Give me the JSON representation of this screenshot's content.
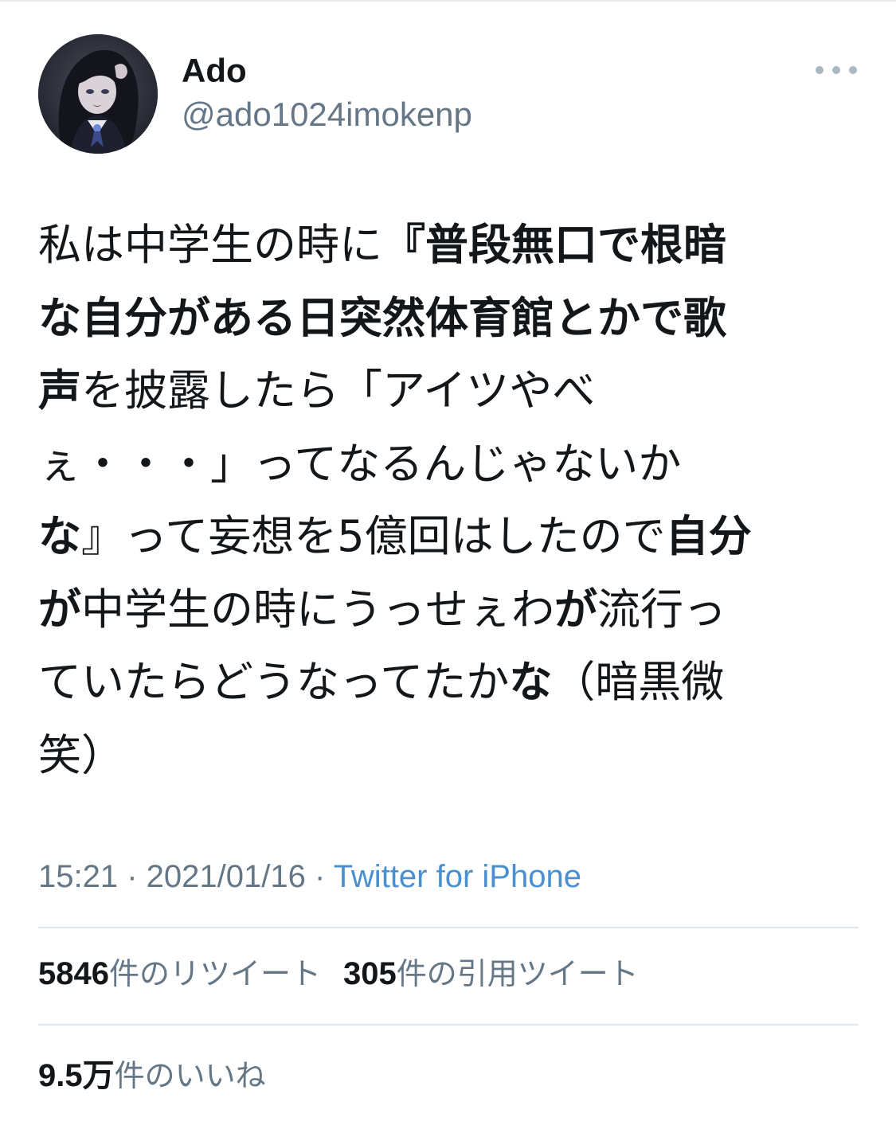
{
  "user": {
    "display_name": "Ado",
    "handle": "@ado1024imokenp"
  },
  "menu": {
    "icon": "more-horizontal-icon"
  },
  "tweet": {
    "lines": [
      [
        {
          "t": "私は中学生の時に",
          "b": false
        },
        {
          "t": "『普段無口で根暗",
          "b": true
        }
      ],
      [
        {
          "t": "な自分がある日突然体育館とかで歌",
          "b": true
        }
      ],
      [
        {
          "t": "声",
          "b": true
        },
        {
          "t": "を披露したら「アイツやべ",
          "b": false
        }
      ],
      [
        {
          "t": "ぇ・・・」ってなるんじゃないか",
          "b": false
        }
      ],
      [
        {
          "t": "な",
          "b": true
        },
        {
          "t": "』って妄想を5億回はしたので",
          "b": false
        },
        {
          "t": "自分",
          "b": true
        }
      ],
      [
        {
          "t": "が",
          "b": true
        },
        {
          "t": "中学生の時にうっせぇわ",
          "b": false
        },
        {
          "t": "が",
          "b": true
        },
        {
          "t": "流行っ",
          "b": false
        }
      ],
      [
        {
          "t": "ていたらどうなってたか",
          "b": false
        },
        {
          "t": "な",
          "b": true
        },
        {
          "t": "（暗黒微",
          "b": false
        }
      ],
      [
        {
          "t": "笑）",
          "b": false
        }
      ]
    ]
  },
  "meta": {
    "time": "15:21",
    "sep1": " · ",
    "date": "2021/01/16",
    "sep2": " · ",
    "source": "Twitter for iPhone"
  },
  "stats": {
    "retweets_count": "5846",
    "retweets_label": "件のリツイート",
    "quotes_count": "305",
    "quotes_label": "件の引用ツイート",
    "likes_count": "9.5万",
    "likes_label": "件のいいね"
  },
  "colors": {
    "text": "#14171a",
    "secondary": "#657786",
    "link": "#4a90d0",
    "divider": "#e1e8ed"
  }
}
